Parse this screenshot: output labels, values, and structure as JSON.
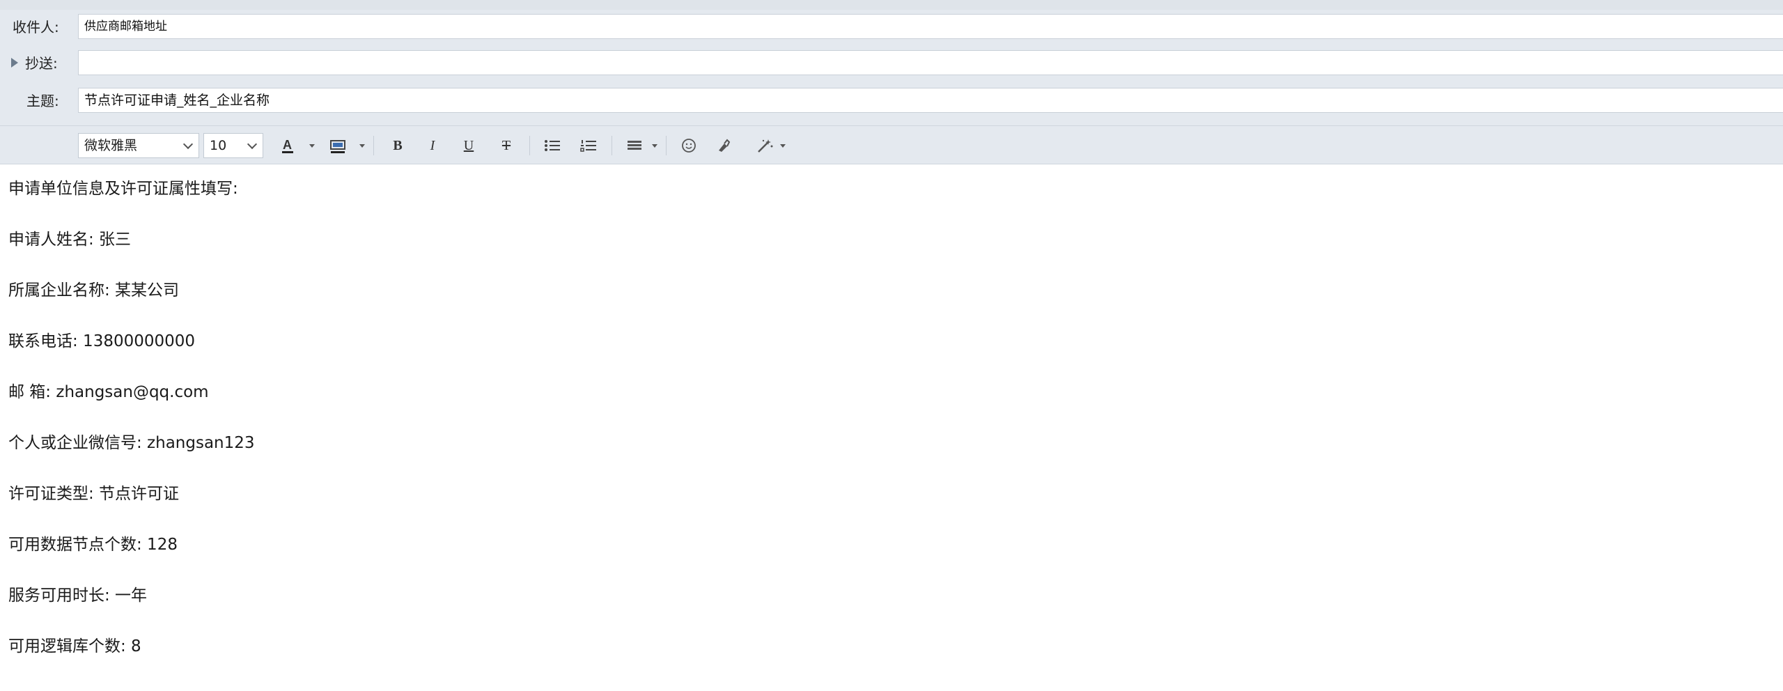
{
  "compose": {
    "to_label": "收件人:",
    "to_value": "供应商邮箱地址",
    "cc_label": "抄送:",
    "cc_value": "",
    "subject_label": "主题:",
    "subject_value": "节点许可证申请_姓名_企业名称"
  },
  "toolbar": {
    "font_family": "微软雅黑",
    "font_size": "10",
    "icons": [
      "font-color-icon",
      "highlight-color-icon",
      "bold-icon",
      "italic-icon",
      "underline-icon",
      "strikethrough-icon",
      "bullet-list-icon",
      "numbered-list-icon",
      "align-icon",
      "emoji-icon",
      "format-painter-icon",
      "magic-wand-icon"
    ]
  },
  "body_lines": [
    "申请单位信息及许可证属性填写:",
    "申请人姓名: 张三",
    "所属企业名称: 某某公司",
    "联系电话: 13800000000",
    "邮 箱: zhangsan@qq.com",
    "个人或企业微信号: zhangsan123",
    "许可证类型: 节点许可证",
    "可用数据节点个数: 128",
    "服务可用时长: 一年",
    "可用逻辑库个数: 8"
  ]
}
